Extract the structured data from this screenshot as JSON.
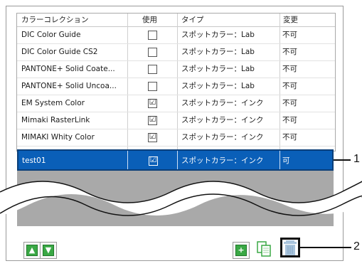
{
  "table": {
    "headers": [
      "カラーコレクション",
      "使用",
      "タイプ",
      "変更"
    ],
    "rows": [
      {
        "name": "DIC Color Guide",
        "used": false,
        "type": "スポットカラー：Lab",
        "change": "不可"
      },
      {
        "name": "DIC Color Guide CS2",
        "used": false,
        "type": "スポットカラー：Lab",
        "change": "不可"
      },
      {
        "name": "PANTONE+ Solid Coate...",
        "used": false,
        "type": "スポットカラー：Lab",
        "change": "不可"
      },
      {
        "name": "PANTONE+ Solid Uncoa...",
        "used": false,
        "type": "スポットカラー：Lab",
        "change": "不可"
      },
      {
        "name": "EM System Color",
        "used": true,
        "type": "スポットカラー：インク",
        "change": "不可"
      },
      {
        "name": "Mimaki RasterLink",
        "used": true,
        "type": "スポットカラー：インク",
        "change": "不可"
      },
      {
        "name": "MIMAKI Whity Color",
        "used": true,
        "type": "スポットカラー：インク",
        "change": "不可"
      }
    ],
    "selected_row": {
      "name": "test01",
      "used": true,
      "type": "スポットカラー：インク",
      "change": "可"
    }
  },
  "checkmark": "☑",
  "buttons": {
    "up": "move-up",
    "down": "move-down",
    "add": "add",
    "duplicate": "duplicate",
    "delete": "delete"
  },
  "callouts": [
    "1",
    "2"
  ],
  "colors": {
    "selection": "#0a5fb8",
    "green": "#3aa845",
    "trash": "#a9c4dc"
  }
}
